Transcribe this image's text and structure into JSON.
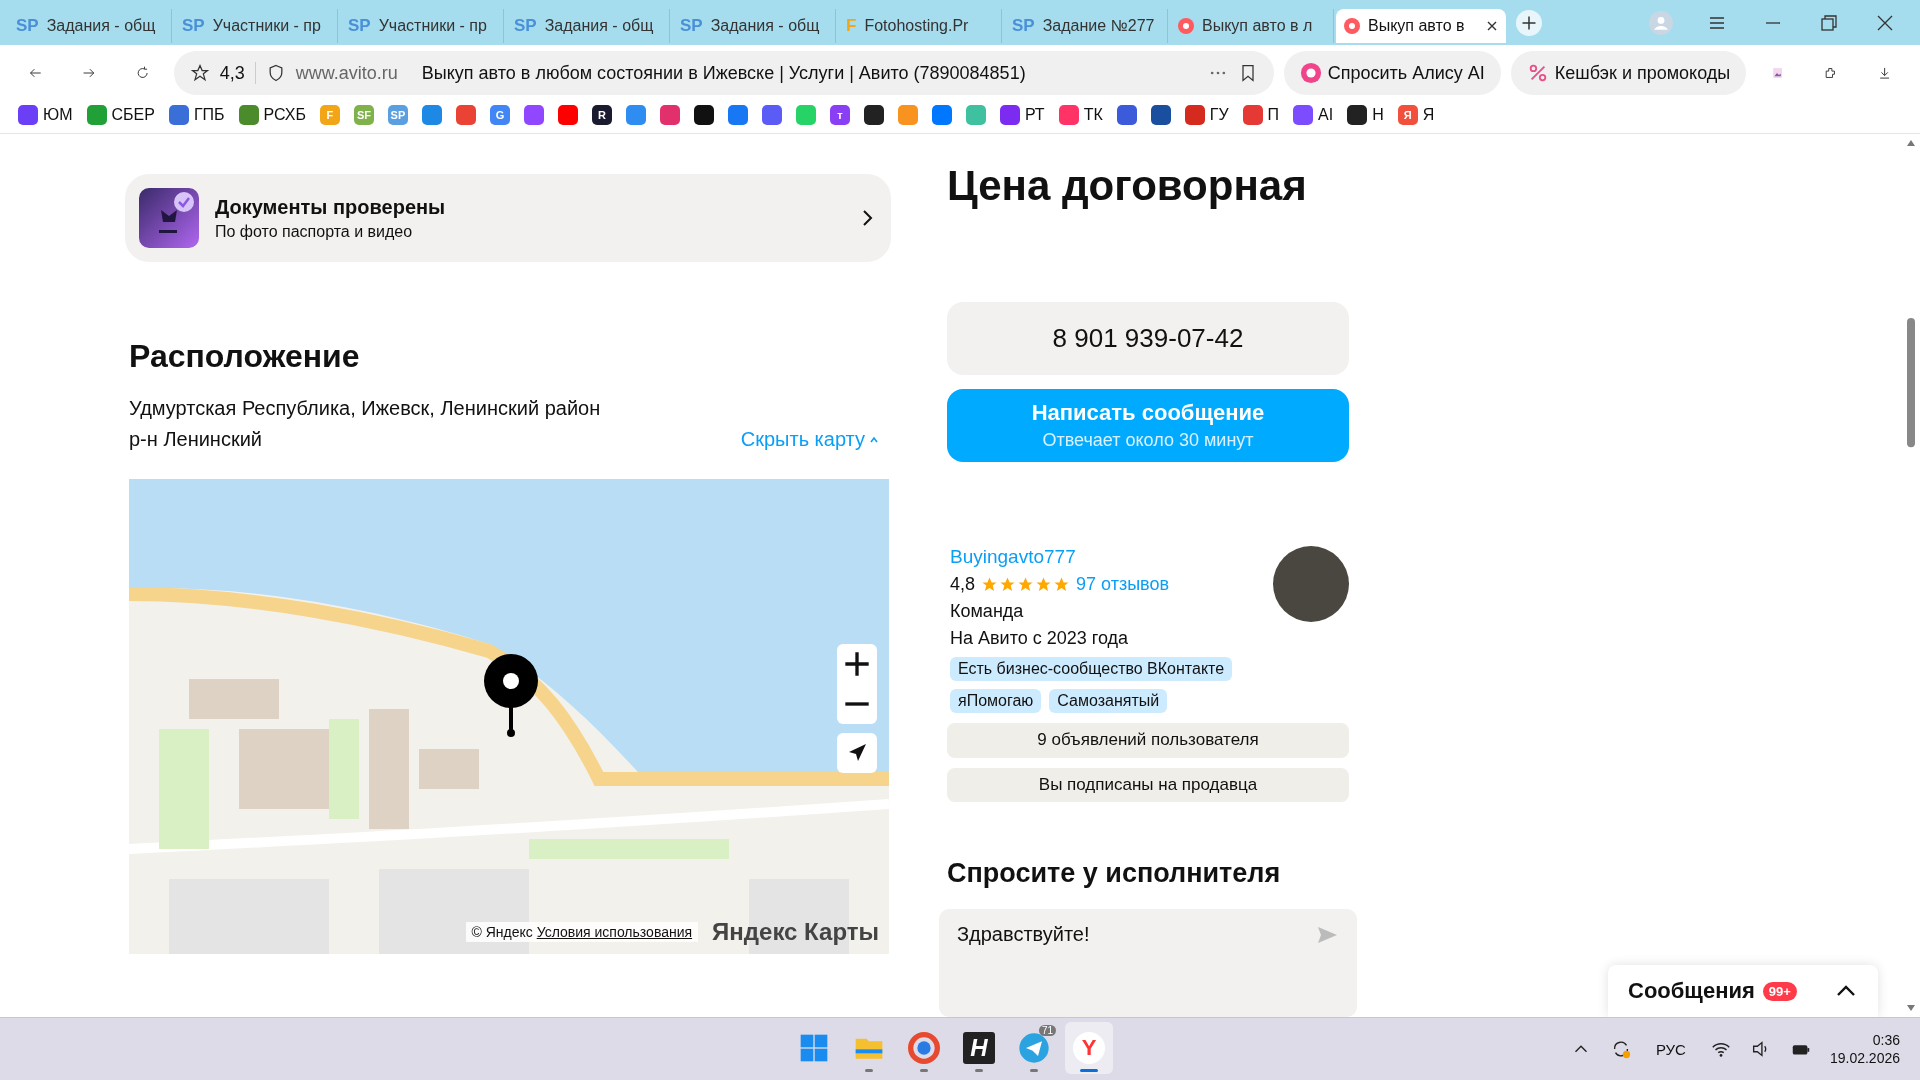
{
  "browser": {
    "tabs": [
      {
        "title": "Задания - общ",
        "logo": "SP",
        "selected": false
      },
      {
        "title": "Участники - пр",
        "logo": "SP",
        "selected": false
      },
      {
        "title": "Участники - пр",
        "logo": "SP",
        "selected": false
      },
      {
        "title": "Задания - общ",
        "logo": "SP",
        "selected": false
      },
      {
        "title": "Задания - общ",
        "logo": "SP",
        "selected": false
      },
      {
        "title": "Fotohosting.Pr",
        "logo": "F",
        "selected": false
      },
      {
        "title": "Задание №277",
        "logo": "SP",
        "selected": false
      },
      {
        "title": "Выкуп авто в л",
        "selected": false
      },
      {
        "title": "Выкуп авто в",
        "selected": true
      }
    ],
    "address_bar": {
      "rating": "4,3",
      "domain": "www.avito.ru",
      "page_title": "Выкуп авто в любом состоянии в Ижевске | Услуги | Авито (7890084851)"
    },
    "alice_button": "Спросить Алису AI",
    "cashback_button": "Кешбэк и промокоды",
    "bookmarks": [
      {
        "label": "ЮМ",
        "color": "#6b3ff5"
      },
      {
        "label": "СБЕР",
        "color": "#21a038"
      },
      {
        "label": "ГПБ",
        "color": "#3b6fd8"
      },
      {
        "label": "РСХБ",
        "color": "#4c8b2b"
      },
      {
        "glyph": "F",
        "color": "#f2a516"
      },
      {
        "glyph": "SF",
        "color": "#7fb24a"
      },
      {
        "glyph": "SP",
        "color": "#5aa0e0"
      },
      {
        "color": "#1e88e5"
      },
      {
        "color": "#ea4335"
      },
      {
        "glyph": "G",
        "color": "#4285f4"
      },
      {
        "color": "#9146ff"
      },
      {
        "color": "#ff0000"
      },
      {
        "glyph": "R",
        "color": "#1b1b2f"
      },
      {
        "color": "#2f8cf0"
      },
      {
        "color": "#e1306c"
      },
      {
        "color": "#111111"
      },
      {
        "color": "#1877f2"
      },
      {
        "color": "#5b5bf6"
      },
      {
        "color": "#25d366"
      },
      {
        "glyph": "т",
        "color": "#8b3ff5"
      },
      {
        "color": "#222222"
      },
      {
        "color": "#f7931e"
      },
      {
        "color": "#0077ff"
      },
      {
        "color": "#3fc1a0"
      },
      {
        "label": "РТ",
        "color": "#7b2cf0"
      },
      {
        "label": "ТК",
        "color": "#ff3366"
      },
      {
        "color": "#3b5bdb"
      },
      {
        "color": "#1a4fa0"
      },
      {
        "label": "ГУ",
        "color": "#d52b1e"
      },
      {
        "label": "П",
        "color": "#e53935"
      },
      {
        "label": "AI",
        "color": "#7c4dff"
      },
      {
        "label": "Н",
        "color": "#222222"
      },
      {
        "glyph": "Я",
        "label": "Я",
        "color": "#f0503c"
      }
    ]
  },
  "page": {
    "documents_card": {
      "title": "Документы проверены",
      "subtitle": "По фото паспорта и видео"
    },
    "location": {
      "heading": "Расположение",
      "address": "Удмуртская Республика, Ижевск, Ленинский район",
      "district": "р-н Ленинский",
      "hide_map_link": "Скрыть карту",
      "map": {
        "attribution": "© Яндекс",
        "terms_link": "Условия использования",
        "logo": "Яндекс Карты"
      }
    },
    "price": "Цена договорная",
    "phone_button": "8 901 939-07-42",
    "message_button": {
      "label": "Написать сообщение",
      "sublabel": "Отвечает около 30 минут"
    },
    "seller": {
      "name": "Buyingavto777",
      "rating": "4,8",
      "stars": 5,
      "reviews": "97 отзывов",
      "type": "Команда",
      "since": "На Авито с 2023 года",
      "tags": [
        [
          "Есть бизнес-сообщество ВКонтакте"
        ],
        [
          "яПомогаю",
          "Самозанятый"
        ]
      ],
      "buttons": [
        "9 объявлений пользователя",
        "Вы подписаны на продавца"
      ]
    },
    "ask": {
      "heading": "Спросите у исполнителя",
      "message": "Здравствуйте!"
    }
  },
  "messages_widget": {
    "title": "Сообщения",
    "badge": "99+"
  },
  "taskbar": {
    "apps": [
      {
        "kind": "start",
        "selected": false
      },
      {
        "kind": "folder",
        "selected": false,
        "running": true
      },
      {
        "kind": "browser",
        "selected": false,
        "running": true
      },
      {
        "kind": "letter",
        "glyph": "H",
        "selected": false,
        "running": true
      },
      {
        "kind": "telegram",
        "badge": "71",
        "selected": false,
        "running": true
      },
      {
        "kind": "yandex",
        "glyph": "Y",
        "selected": true,
        "running": true
      }
    ],
    "language": "РУС",
    "time": "0:36",
    "date": "19.02.2026"
  }
}
